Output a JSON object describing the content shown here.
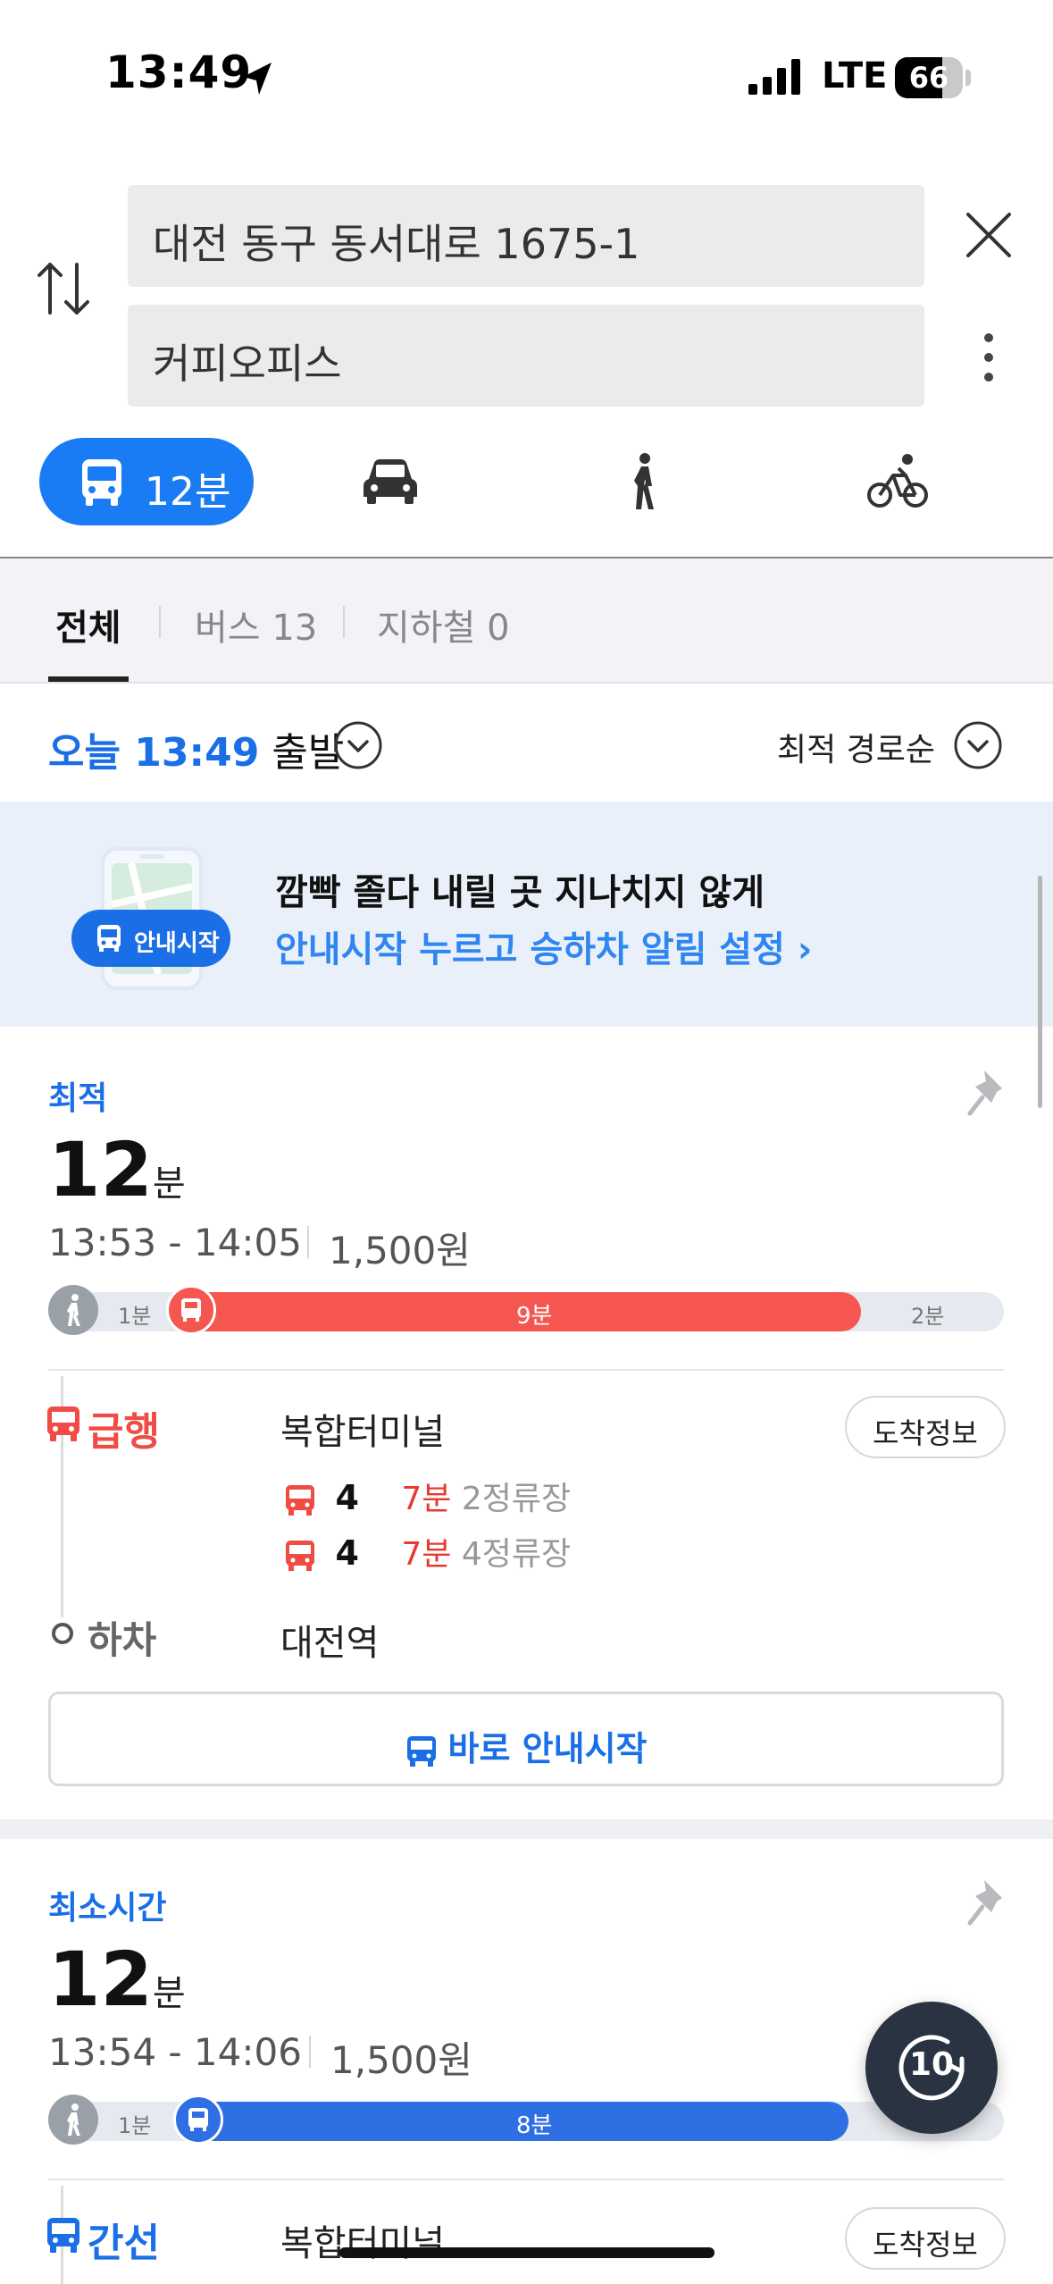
{
  "status_bar": {
    "time": "13:49",
    "network": "LTE",
    "battery": "66"
  },
  "search": {
    "origin": "대전 동구 동서대로 1675-1",
    "destination": "커피오피스"
  },
  "modes": {
    "bus_label": "12분"
  },
  "subtabs": {
    "all": "전체",
    "bus": "버스 13",
    "subway": "지하철 0"
  },
  "departure": {
    "prefix": "오늘 13:49",
    "suffix": "출발",
    "sort": "최적 경로순"
  },
  "banner": {
    "title": "깜빡 졸다 내릴 곳 지나치지 않게",
    "subtitle": "안내시작 누르고 승하차 알림 설정 ›",
    "pill": "안내시작"
  },
  "route1": {
    "tag": "최적",
    "duration": "12",
    "unit": "분",
    "times": "13:53 - 14:05",
    "fare": "1,500원",
    "bar": {
      "walk_start": "1분",
      "ride": "9분",
      "walk_end": "2분"
    },
    "bus_type": "급행",
    "board_stop": "복합터미널",
    "info_button": "도착정보",
    "arrivals": [
      {
        "bus": "4",
        "mins": "7분",
        "stops": "2정류장"
      },
      {
        "bus": "4",
        "mins": "7분",
        "stops": "4정류장"
      }
    ],
    "alight_label": "하차",
    "alight_stop": "대전역",
    "start_button": "바로 안내시작"
  },
  "route2": {
    "tag": "최소시간",
    "duration": "12",
    "unit": "분",
    "times": "13:54 - 14:06",
    "fare": "1,500원",
    "bar": {
      "walk_start": "1분",
      "ride": "8분"
    },
    "bus_type": "간선",
    "board_stop": "복합터미널",
    "info_button": "도착정보"
  },
  "fab": {
    "label": "10"
  },
  "colors": {
    "accent": "#1a7cf5",
    "express_red": "#f55750",
    "trunk_blue": "#2f6fe4"
  }
}
